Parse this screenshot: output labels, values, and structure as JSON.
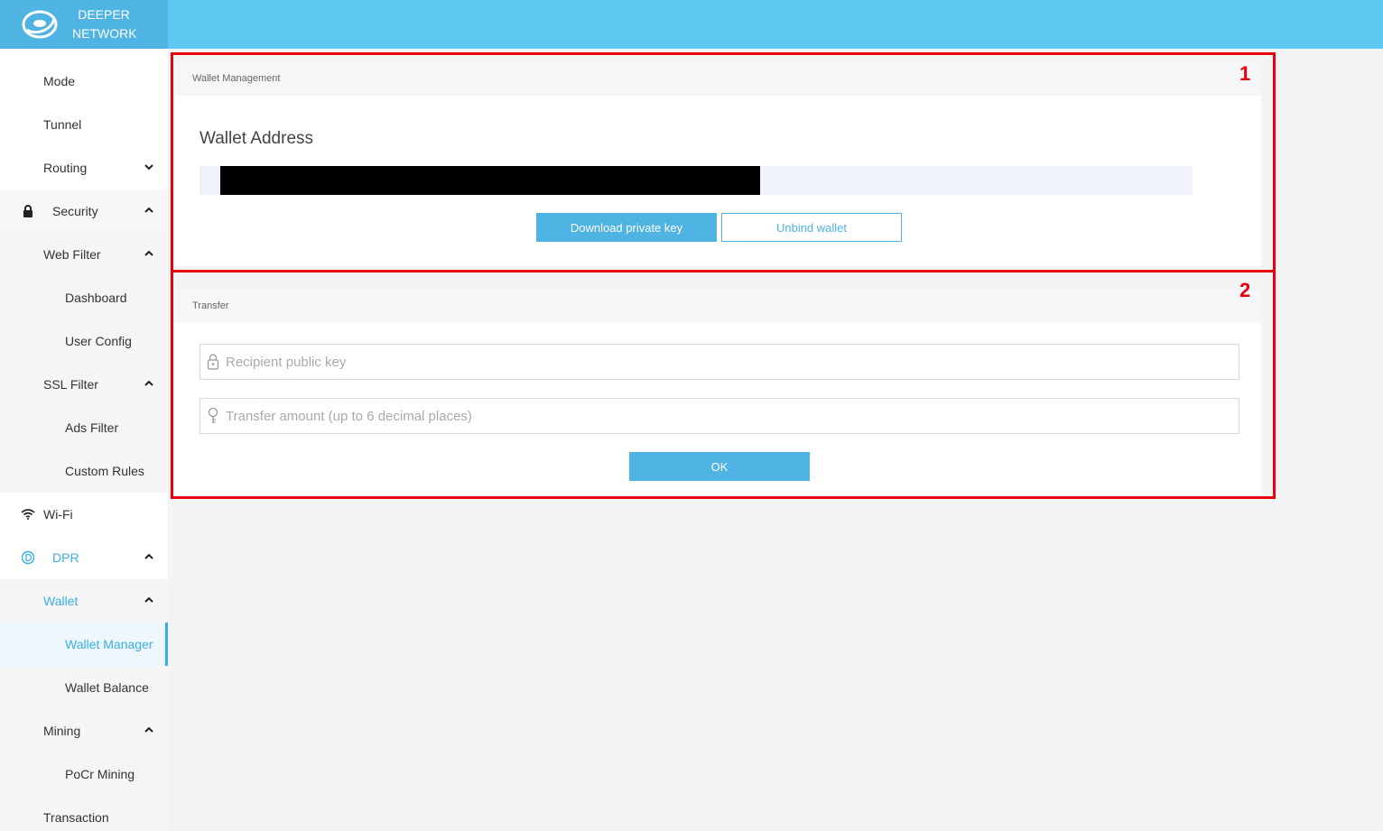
{
  "header": {
    "brand_line1": "DEEPER",
    "brand_line2": "NETWORK"
  },
  "sidebar": {
    "items": [
      {
        "label": "Mode"
      },
      {
        "label": "Tunnel"
      },
      {
        "label": "Routing"
      },
      {
        "label": "Security"
      },
      {
        "label": "Web Filter"
      },
      {
        "label": "Dashboard"
      },
      {
        "label": "User Config"
      },
      {
        "label": "SSL Filter"
      },
      {
        "label": "Ads Filter"
      },
      {
        "label": "Custom Rules"
      },
      {
        "label": "Wi-Fi"
      },
      {
        "label": "DPR"
      },
      {
        "label": "Wallet"
      },
      {
        "label": "Wallet Manager"
      },
      {
        "label": "Wallet Balance"
      },
      {
        "label": "Mining"
      },
      {
        "label": "PoCr Mining"
      },
      {
        "label": "Transaction"
      }
    ]
  },
  "wallet_management": {
    "header": "Wallet Management",
    "title": "Wallet Address",
    "download_label": "Download private key",
    "unbind_label": "Unbind wallet"
  },
  "transfer": {
    "header": "Transfer",
    "recipient_placeholder": "Recipient public key",
    "amount_placeholder": "Transfer amount (up to 6 decimal places)",
    "ok_label": "OK"
  },
  "annotations": {
    "box1": "1",
    "box2": "2"
  },
  "colors": {
    "topbar": "#5ec8f2",
    "accent": "#4fb3e4",
    "highlight": "#e8000e"
  }
}
